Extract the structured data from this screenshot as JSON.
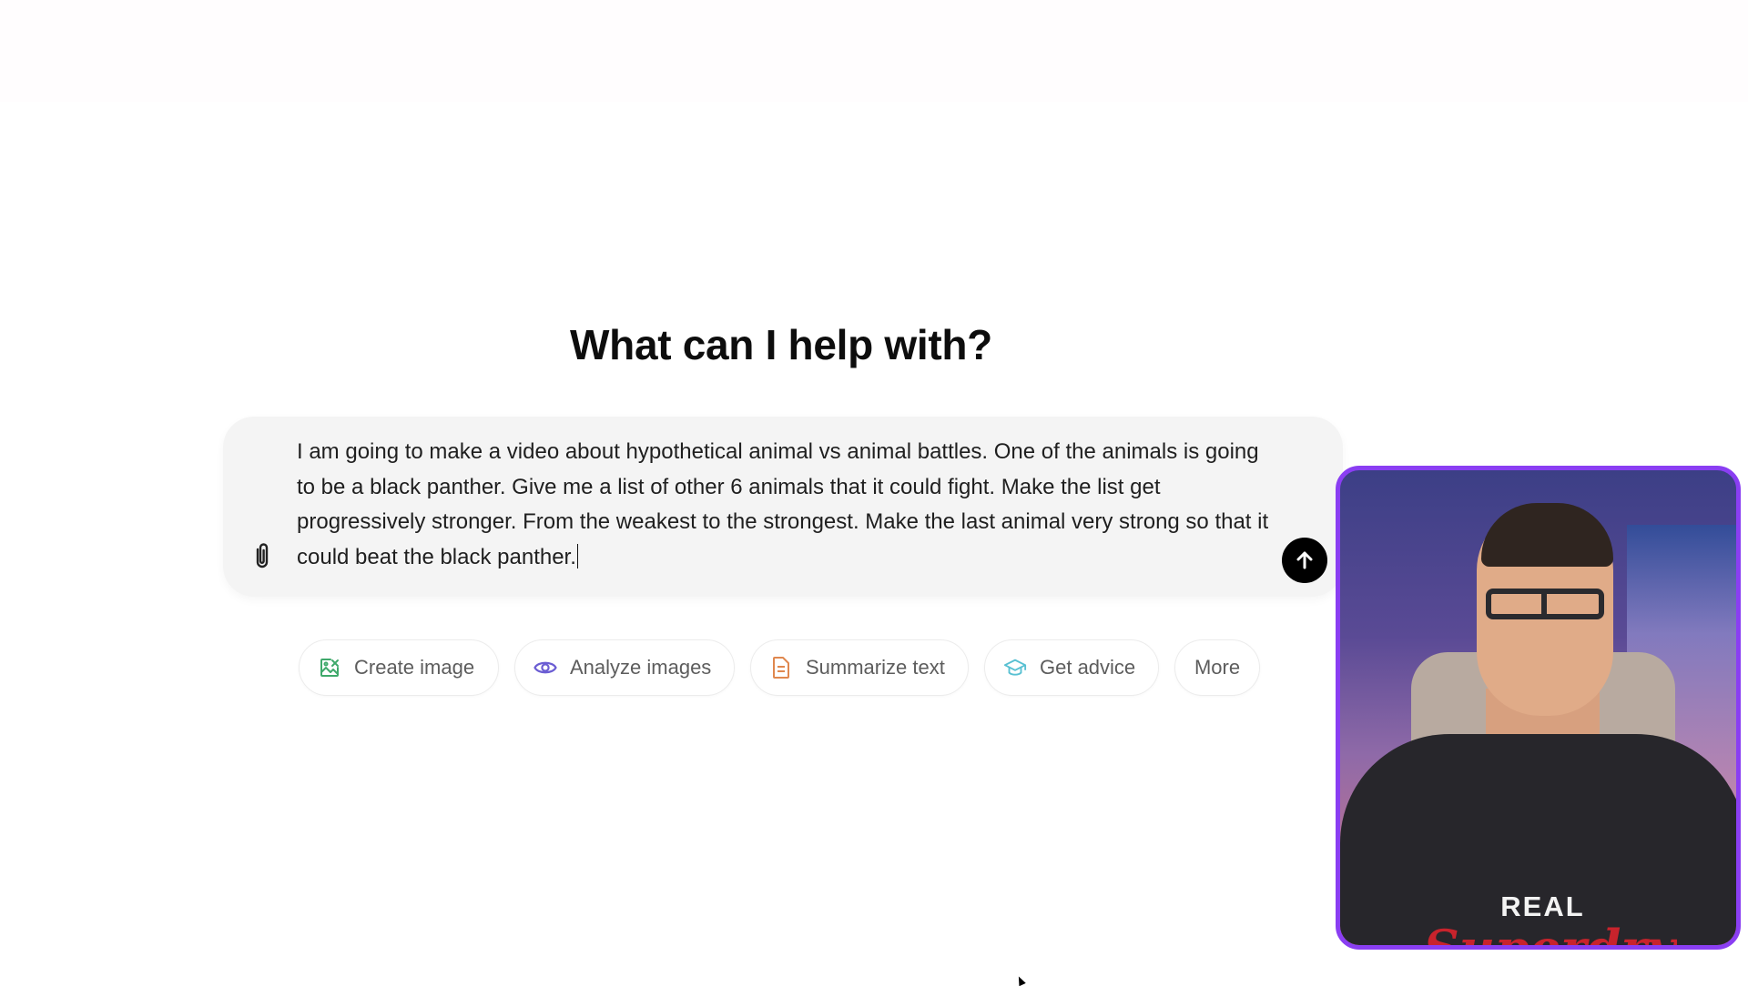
{
  "heading": "What can I help with?",
  "composer": {
    "value": "I am going to make a video about hypothetical animal vs animal battles. One of the animals is going to be a black panther. Give me a list of other 6 animals that it could fight. Make the list get progressively stronger. From the weakest to the strongest. Make the last animal very strong so that it could beat the black panther.",
    "attach_icon": "paperclip-icon",
    "send_icon": "arrow-up-icon"
  },
  "chips": [
    {
      "label": "Create image",
      "icon": "create-image-icon",
      "color": "#3fa96b"
    },
    {
      "label": "Analyze images",
      "icon": "eye-icon",
      "color": "#6b5dd3"
    },
    {
      "label": "Summarize text",
      "icon": "document-icon",
      "color": "#e0884f"
    },
    {
      "label": "Get advice",
      "icon": "graduation-cap-icon",
      "color": "#58c0d2"
    },
    {
      "label": "More"
    }
  ],
  "webcam": {
    "border_color": "#8a3ef2",
    "shirt_text": "REAL",
    "shirt_logo": "Superdry"
  }
}
